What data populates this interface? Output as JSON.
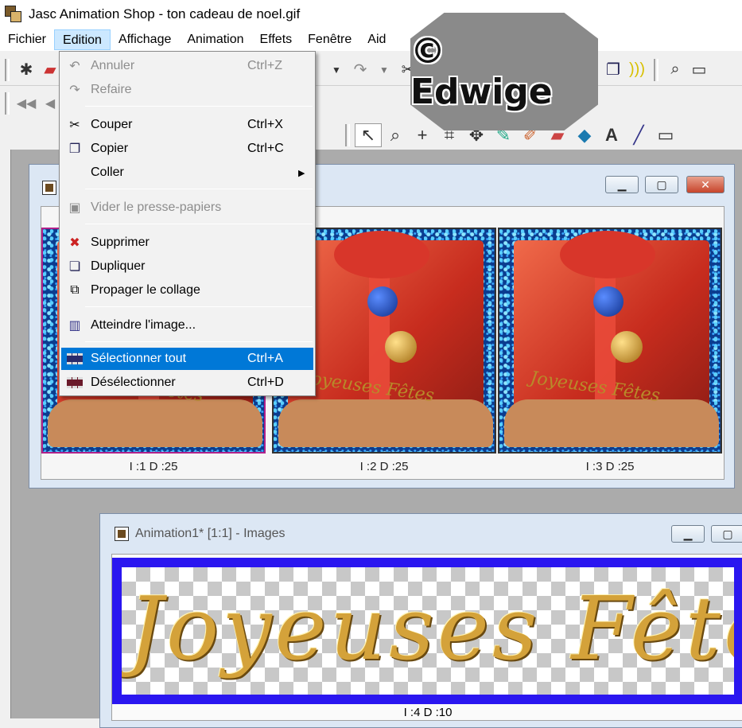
{
  "window": {
    "title": "Jasc Animation Shop - ton cadeau de noel.gif"
  },
  "menubar": {
    "items": [
      "Fichier",
      "Edition",
      "Affichage",
      "Animation",
      "Effets",
      "Fenêtre",
      "Aid"
    ]
  },
  "edit_menu": {
    "items": [
      {
        "label": "Annuler",
        "shortcut": "Ctrl+Z",
        "icon": "undo-icon",
        "enabled": false
      },
      {
        "label": "Refaire",
        "shortcut": "",
        "icon": "redo-icon",
        "enabled": false
      },
      {
        "label": "Couper",
        "shortcut": "Ctrl+X",
        "icon": "scissors-icon",
        "enabled": true
      },
      {
        "label": "Copier",
        "shortcut": "Ctrl+C",
        "icon": "copy-icon",
        "enabled": true
      },
      {
        "label": "Coller",
        "shortcut": "",
        "icon": "",
        "enabled": true,
        "submenu": true
      },
      {
        "label": "Vider le presse-papiers",
        "shortcut": "",
        "icon": "clipboard-clear-icon",
        "enabled": false
      },
      {
        "label": "Supprimer",
        "shortcut": "",
        "icon": "delete-icon",
        "enabled": true
      },
      {
        "label": "Dupliquer",
        "shortcut": "",
        "icon": "duplicate-icon",
        "enabled": true
      },
      {
        "label": "Propager le collage",
        "shortcut": "",
        "icon": "propagate-paste-icon",
        "enabled": true
      },
      {
        "label": "Atteindre l'image...",
        "shortcut": "",
        "icon": "goto-frame-icon",
        "enabled": true
      },
      {
        "label": "Sélectionner tout",
        "shortcut": "Ctrl+A",
        "icon": "select-all-icon",
        "enabled": true,
        "highlighted": true
      },
      {
        "label": "Désélectionner",
        "shortcut": "Ctrl+D",
        "icon": "deselect-icon",
        "enabled": true
      }
    ]
  },
  "watermark": {
    "text": "© Edwige"
  },
  "animation_window": {
    "frames": [
      {
        "label": "I :1   D :25",
        "selected": true
      },
      {
        "label": "I :2   D :25",
        "selected": false
      },
      {
        "label": "I :3   D :25",
        "selected": false
      }
    ],
    "frame_text": "Joyeuses Fêtes"
  },
  "second_window": {
    "title": "Animation1* [1:1] - Images",
    "frame_text": "Joyeuses Fêtes",
    "frame_label": "I :4   D :10"
  },
  "colors": {
    "menu_highlight": "#0078d7",
    "menubar_active": "#cce8ff",
    "frame_border": "#2a16f0"
  }
}
